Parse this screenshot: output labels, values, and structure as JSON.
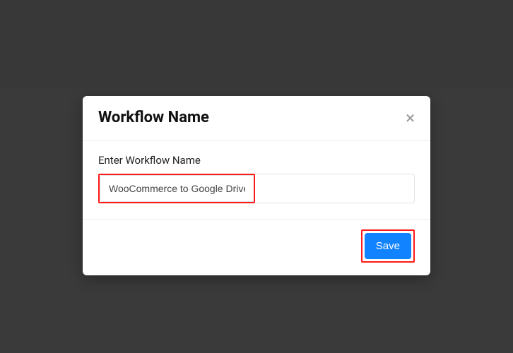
{
  "modal": {
    "title": "Workflow Name",
    "close_label": "×",
    "field_label": "Enter Workflow Name",
    "input_value": "WooCommerce to Google Drive",
    "save_label": "Save"
  }
}
